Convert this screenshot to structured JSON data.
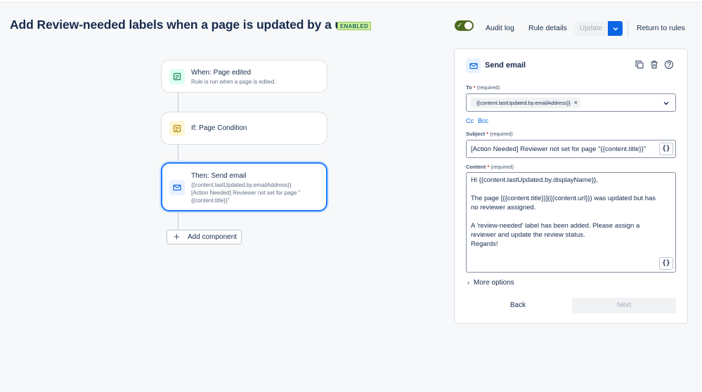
{
  "header": {
    "title": "Add Review-needed labels when a page is updated by a user",
    "status_badge": "ENABLED",
    "audit_log": "Audit log",
    "rule_details": "Rule details",
    "update": "Update",
    "return_to_rules": "Return to rules",
    "toggle_on": true
  },
  "flow": {
    "trigger": {
      "title": "When: Page edited",
      "subtitle": "Rule is run when a page is edited."
    },
    "condition": {
      "title": "If: Page Condition"
    },
    "action": {
      "title": "Then: Send email",
      "line1": "{{content.lastUpdated.by.emailAddress}}",
      "line2": "[Action Needed] Reviewer not set for page \"",
      "line3": "{{content.title}}\""
    },
    "add_component": "Add component"
  },
  "panel": {
    "title": "Send email",
    "to_label": "To",
    "required_marker": "*",
    "required_text": "(required)",
    "to_chip": "{{content.lastUpdated.by.emailAddress}}",
    "cc": "Cc",
    "bcc": "Bcc",
    "subject_label": "Subject",
    "subject_value": "[Action Needed] Reviewer not set for page \"{{content.title}}\"",
    "content_label": "Content",
    "content_lines": [
      "Hi {{content.lastUpdated.by.displayName}},",
      "",
      "The page [{{content.title}}]({{content.url}}) was updated but has",
      "no reviewer assigned.",
      "",
      "A 'review-needed' label has been added. Please assign a",
      "reviewer and update the review status.",
      "Regards!"
    ],
    "brace_label": "{}",
    "more_options": "More options",
    "back": "Back",
    "next": "Next"
  },
  "icons": {
    "trigger": "page-edit-icon",
    "condition": "condition-doc-icon",
    "action": "email-icon",
    "duplicate": "duplicate-icon",
    "delete": "trash-icon",
    "help": "help-icon"
  },
  "colors": {
    "accent": "#0c66e4",
    "selected_border": "#1d7afc",
    "toggle": "#4c6b1f",
    "badge_bg": "#d3f1a7",
    "trigger_icon_bg": "#dcfff1",
    "condition_icon_bg": "#fff7d6",
    "action_icon_bg": "#e9f2ff"
  }
}
